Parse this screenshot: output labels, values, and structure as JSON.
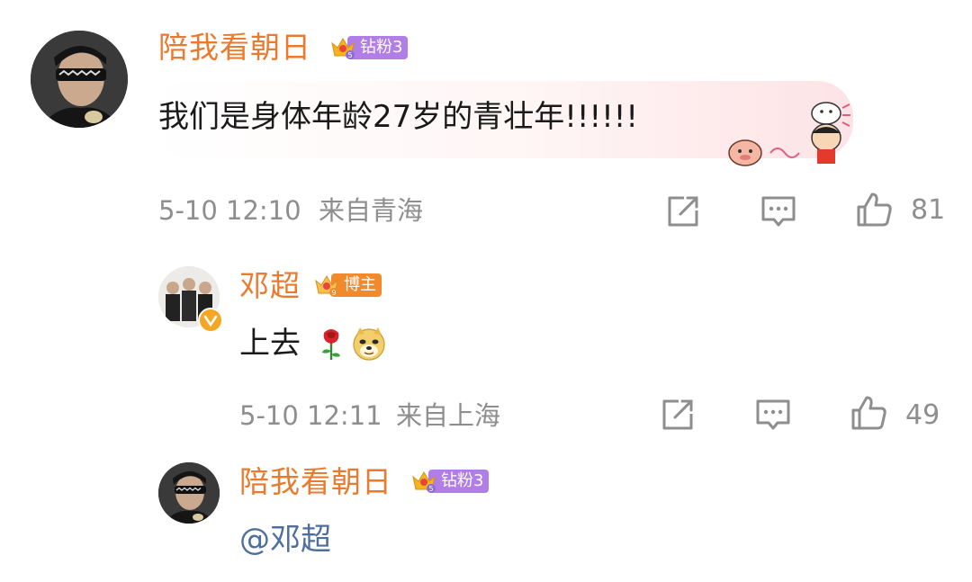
{
  "comments": [
    {
      "username": "陪我看朝日",
      "badge_label": "钻粉3",
      "text": "我们是身体年龄27岁的青壮年!!!!!!",
      "date": "5-10 12:10",
      "location": "来自青海",
      "likes": "81"
    },
    {
      "username": "邓超",
      "badge_label": "博主",
      "text": "上去",
      "emojis": [
        "rose-emoji",
        "doge-emoji"
      ],
      "date": "5-10 12:11",
      "location": "来自上海",
      "likes": "49"
    },
    {
      "username": "陪我看朝日",
      "badge_label": "钻粉3",
      "mention": "@邓超"
    }
  ],
  "colors": {
    "username": "#ea7a2e",
    "fan_badge": "#b07ee6",
    "blogger_badge": "#f08a2c",
    "meta": "#8e8e8e",
    "mention": "#4e6f9e",
    "verified": "#f5a623"
  }
}
